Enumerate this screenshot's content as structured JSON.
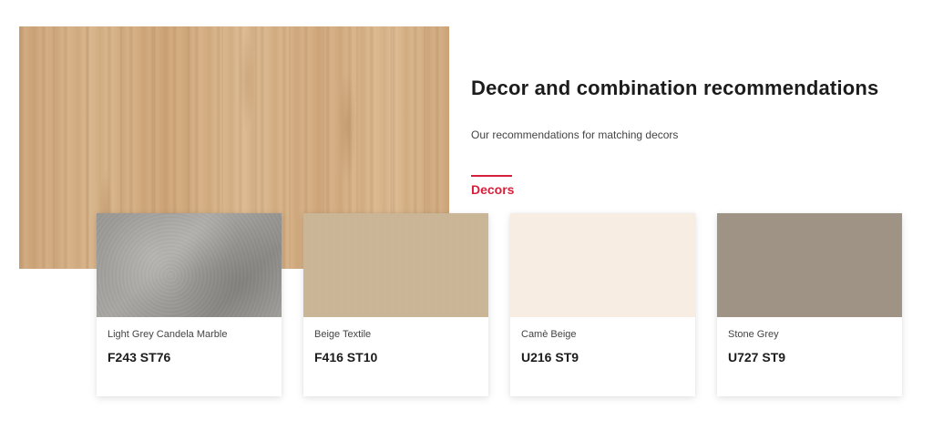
{
  "section": {
    "title": "Decor and combination recommendations",
    "subtitle": "Our recommendations for matching decors",
    "tab_label": "Decors",
    "accent_color": "#d5203c"
  },
  "hero": {
    "image": "oak-wood-decor"
  },
  "cards": [
    {
      "name": "Light Grey Candela Marble",
      "code": "F243 ST76",
      "swatch_color": "#9e9c98"
    },
    {
      "name": "Beige Textile",
      "code": "F416 ST10",
      "swatch_color": "#d0bb9a"
    },
    {
      "name": "Camè Beige",
      "code": "U216 ST9",
      "swatch_color": "#f8ede2"
    },
    {
      "name": "Stone Grey",
      "code": "U727 ST9",
      "swatch_color": "#9e9384"
    }
  ]
}
